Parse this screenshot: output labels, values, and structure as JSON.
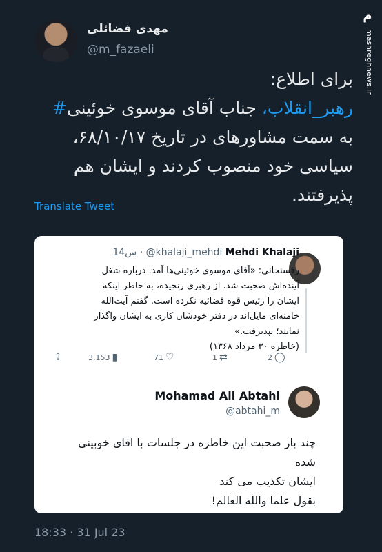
{
  "author": {
    "display_name": "مهدی فضائلی",
    "handle": "@m_fazaeli"
  },
  "watermark": {
    "logo_text": "مشرق",
    "site": "mashreghnews.ir"
  },
  "tweet": {
    "lines": [
      "برای اطلاع:",
      "جناب آقای موسوی خوئینی",
      "رهبر_انقلاب،",
      "به سمت مشاورهای در تاریخ ۶۸/۱۰/۱۷،",
      "سیاسی خود منصوب کردند و ایشان هم",
      "پذیرفتند."
    ],
    "hashtag_prefix": "#"
  },
  "translate_label": "Translate Tweet",
  "quote1": {
    "name": "Mehdi Khalaji",
    "handle": "@khalaji_mehdi",
    "time": "14س",
    "body_lines": [
      "رفسنجانی: «آقای موسوی خوئینی‌ها آمد. درباره شغل",
      "آینده‌اش صحبت شد. از رهبری رنجیده، به خاطر اینکه",
      "ایشان را رئیس قوه قضائیه نکرده است. گفتم آیت‌الله",
      "خامنه‌ای مایل‌اند در دفتر خودشان کاری به ایشان واگذار",
      "نمایند؛ نپذیرفت.»",
      "(خاطره ۳۰ مرداد ۱۳۶۸)"
    ],
    "actions": {
      "replies": "2",
      "retweets": "1",
      "likes": "71",
      "views": "3,153"
    }
  },
  "quote2": {
    "name": "Mohamad Ali Abtahi",
    "handle": "@abtahi_m",
    "body_lines": [
      "چند بار صحبت این خاطره در جلسات با اقای خوبینی",
      "شده",
      "ایشان تکذیب می کند",
      "بقول علما والله العالم!"
    ]
  },
  "timestamp": "18:33 · 31 Jul 23",
  "colors": {
    "background": "#15202b",
    "accent": "#1d9bf0",
    "text": "#e7e9ea",
    "muted": "#8b98a5"
  }
}
